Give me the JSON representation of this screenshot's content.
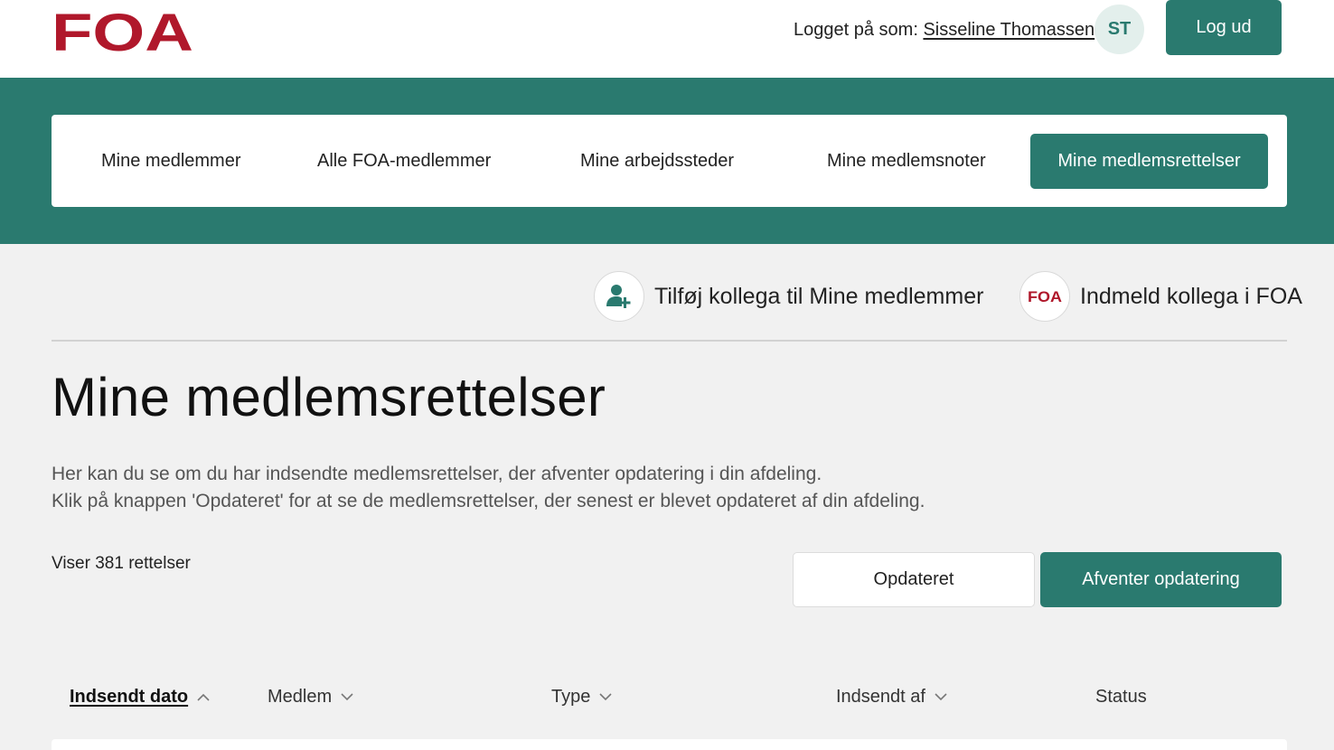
{
  "header": {
    "logo_text": "FOA",
    "logged_in_prefix": "Logget på som:",
    "user_name": "Sisseline Thomassen",
    "avatar_initials": "ST",
    "logout_label": "Log ud"
  },
  "nav": {
    "items": [
      {
        "label": "Mine medlemmer"
      },
      {
        "label": "Alle FOA-medlemmer"
      },
      {
        "label": "Mine arbejdssteder"
      },
      {
        "label": "Mine medlemsnoter"
      },
      {
        "label": "Mine medlemsrettelser",
        "active": true
      }
    ]
  },
  "actions": {
    "add_colleague": "Tilføj kollega til Mine medlemmer",
    "enroll_colleague": "Indmeld kollega i FOA",
    "enroll_logo_text": "FOA"
  },
  "main": {
    "title": "Mine medlemsrettelser",
    "description_line1": "Her kan du se om du har indsendte medlemsrettelser, der afventer opdatering i din afdeling.",
    "description_line2": "Klik på knappen 'Opdateret' for at se de medlemsrettelser, der senest er blevet opdateret af din afdeling.",
    "count_text": "Viser 381 rettelser",
    "toggle_updated": "Opdateret",
    "toggle_pending": "Afventer opdatering"
  },
  "table": {
    "columns": [
      {
        "label": "Indsendt dato",
        "sort": "ascending"
      },
      {
        "label": "Medlem",
        "sort": "none"
      },
      {
        "label": "Type",
        "sort": "none"
      },
      {
        "label": "Indsendt af",
        "sort": "none"
      },
      {
        "label": "Status"
      }
    ]
  },
  "colors": {
    "brand_green": "#2a7a6f",
    "brand_red": "#b0182b",
    "background": "#f1f1f1"
  }
}
